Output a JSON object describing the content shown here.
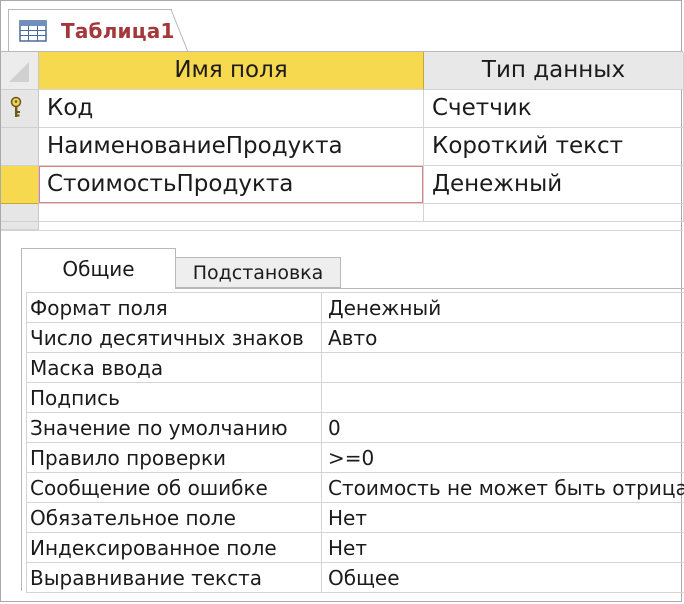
{
  "document_tab": {
    "title": "Таблица1",
    "icon": "table-icon"
  },
  "grid": {
    "headers": {
      "name": "Имя поля",
      "type": "Тип данных"
    },
    "rows": [
      {
        "name": "Код",
        "type": "Счетчик",
        "primary_key": true
      },
      {
        "name": "НаименованиеПродукта",
        "type": "Короткий текст",
        "primary_key": false
      },
      {
        "name": "СтоимостьПродукта",
        "type": "Денежный",
        "primary_key": false
      }
    ]
  },
  "property_tabs": [
    {
      "label": "Общие",
      "active": true
    },
    {
      "label": "Подстановка",
      "active": false
    }
  ],
  "properties": [
    {
      "label": "Формат поля",
      "value": "Денежный"
    },
    {
      "label": "Число десятичных знаков",
      "value": "Авто"
    },
    {
      "label": "Маска ввода",
      "value": ""
    },
    {
      "label": "Подпись",
      "value": ""
    },
    {
      "label": "Значение по умолчанию",
      "value": "0"
    },
    {
      "label": "Правило проверки",
      "value": ">=0"
    },
    {
      "label": "Сообщение об ошибке",
      "value": "Стоимость не может быть отрицательной"
    },
    {
      "label": "Обязательное поле",
      "value": "Нет"
    },
    {
      "label": "Индексированное поле",
      "value": "Нет"
    },
    {
      "label": "Выравнивание текста",
      "value": "Общее"
    }
  ],
  "colors": {
    "accent_yellow": "#f7d94f",
    "tab_title_red": "#a4373a",
    "active_cell_border": "#e0807f"
  }
}
